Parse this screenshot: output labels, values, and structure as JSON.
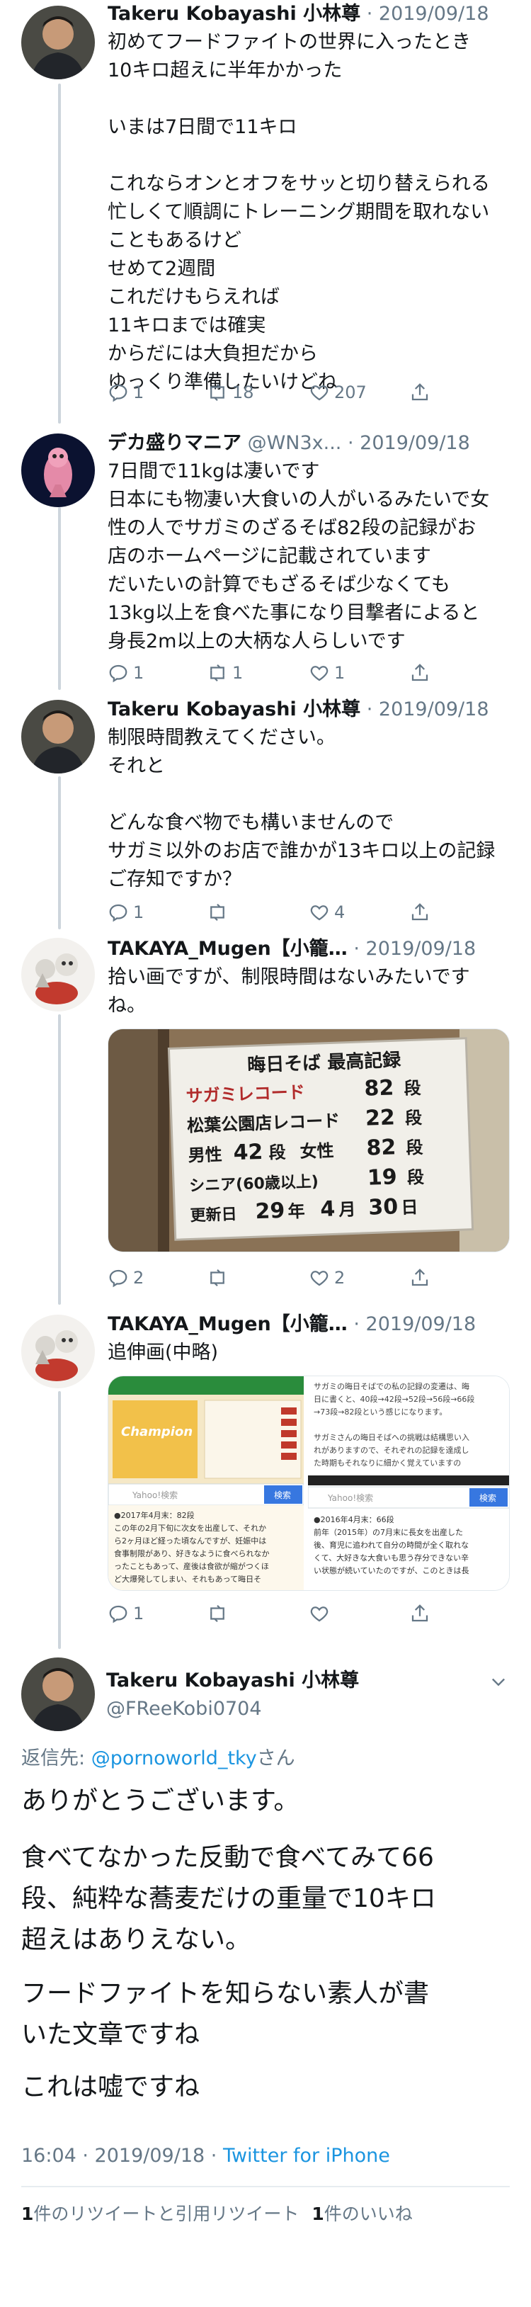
{
  "tweets": [
    {
      "name": "Takeru Kobayashi 小林尊",
      "handle": "",
      "date": "2019/09/18",
      "lines": [
        "初めてフードファイトの世界に入ったとき",
        "10キロ超えに半年かかった",
        "",
        "いまは7日間で11キロ",
        "",
        "これならオンとオフをサッと切り替えられる",
        "忙しくて順調にトレーニング期間を取れない",
        "こともあるけど",
        "せめて2週間",
        "これだけもらえれば",
        "11キロまでは確実",
        "からだには大負担だから",
        "ゆっくり準備したいけどね"
      ],
      "replies": "1",
      "retweets": "18",
      "likes": "207"
    },
    {
      "name": "デカ盛りマニア",
      "handle": "@WN3x...",
      "date": "2019/09/18",
      "lines": [
        "7日間で11kgは凄いです",
        "日本にも物凄い大食いの人がいるみたいで女",
        "性の人でサガミのざるそば82段の記録がお",
        "店のホームページに記載されています",
        "だいたいの計算でもざるそば少なくても",
        "13kg以上を食べた事になり目撃者によると",
        "身長2m以上の大柄な人らしいです"
      ],
      "replies": "1",
      "retweets": "1",
      "likes": "1"
    },
    {
      "name": "Takeru Kobayashi 小林尊",
      "handle": "",
      "date": "2019/09/18",
      "lines": [
        "制限時間教えてください。",
        "それと",
        "",
        "どんな食べ物でも構いませんので",
        "サガミ以外のお店で誰かが13キロ以上の記録",
        "ご存知ですか？"
      ],
      "replies": "1",
      "retweets": "",
      "likes": "4"
    },
    {
      "name": "TAKAYA_Mugen【小籠…",
      "handle": "",
      "date": "2019/09/18",
      "lines": [
        "拾い画ですが、制限時間はないみたいです",
        "ね。"
      ],
      "replies": "2",
      "retweets": "",
      "likes": "2"
    },
    {
      "name": "TAKAYA_Mugen【小籠…",
      "handle": "",
      "date": "2019/09/18",
      "lines": [
        "追伸画(中略)"
      ],
      "replies": "1",
      "retweets": "",
      "likes": ""
    }
  ],
  "sign": {
    "title": "晦日そば 最高記録",
    "rows": [
      {
        "label": "サガミレコード",
        "value": "82",
        "unit": "段"
      },
      {
        "label": "松葉公園店レコード",
        "value": "22",
        "unit": "段"
      }
    ],
    "male_label": "男性",
    "male_value": "42",
    "female_label": "女性",
    "female_value": "82",
    "unit": "段",
    "senior_label": "シニア(60歳以上)",
    "senior_value": "19",
    "updated_label": "更新日",
    "updated_year": "29",
    "year_unit": "年",
    "updated_month": "4",
    "month_unit": "月",
    "updated_day": "30",
    "day_unit": "日"
  },
  "collage": {
    "left_banner": "Champion",
    "left_search": "Yahoo!検索",
    "search_btn": "検索",
    "left_caption": [
      "●2017年4月末：82段",
      "この年の2月下旬に次女を出産して、それか",
      "ら2ヶ月ほど経った頃なんですが、妊娠中は",
      "食事制限があり、好きなように食べられなか",
      "ったこともあって、産後は食欲が縮がつくほ",
      "ど大爆発してしまい、それもあって晦日そ"
    ],
    "right_top": [
      "サガミの晦日そばでの私の記録の変遷は、晦",
      "日に書くと、40段→42段→52段→56段→66段",
      "→73段→82段という感じになります。",
      "",
      "サガミさんの晦日そばへの挑戦は結構思い入",
      "れがありますので、それぞれの記録を達成し",
      "た時期もそれなりに細かく覚えていますの"
    ],
    "right_search": "Yahoo!検索",
    "right_caption": [
      "●2016年4月末：66段",
      "前年（2015年）の7月末に長女を出産した",
      "後、育児に追われて自分の時間が全く取れな",
      "くて、大好きな大食いも思う存分できない辛",
      "い状態が続いていたのですが、このときは長"
    ]
  },
  "main": {
    "name": "Takeru Kobayashi 小林尊",
    "handle": "@FReeKobi0704",
    "reply_prefix": "返信先: ",
    "reply_to": "@pornoworld_tky",
    "reply_suffix": "さん",
    "paragraphs": [
      [
        "ありがとうございます。"
      ],
      [
        "食べてなかった反動で食べてみて66",
        "段、純粋な蕎麦だけの重量で10キロ",
        "超えはありえない。"
      ],
      [
        "フードファイトを知らない素人が書",
        "いた文章ですね"
      ],
      [
        "これは嘘ですね"
      ]
    ],
    "time": "16:04 · 2019/09/18 · ",
    "client": "Twitter for iPhone",
    "rt_count": "1",
    "rt_label": "件のリツイートと引用リツイート",
    "like_count": "1",
    "like_label": "件のいいね"
  }
}
